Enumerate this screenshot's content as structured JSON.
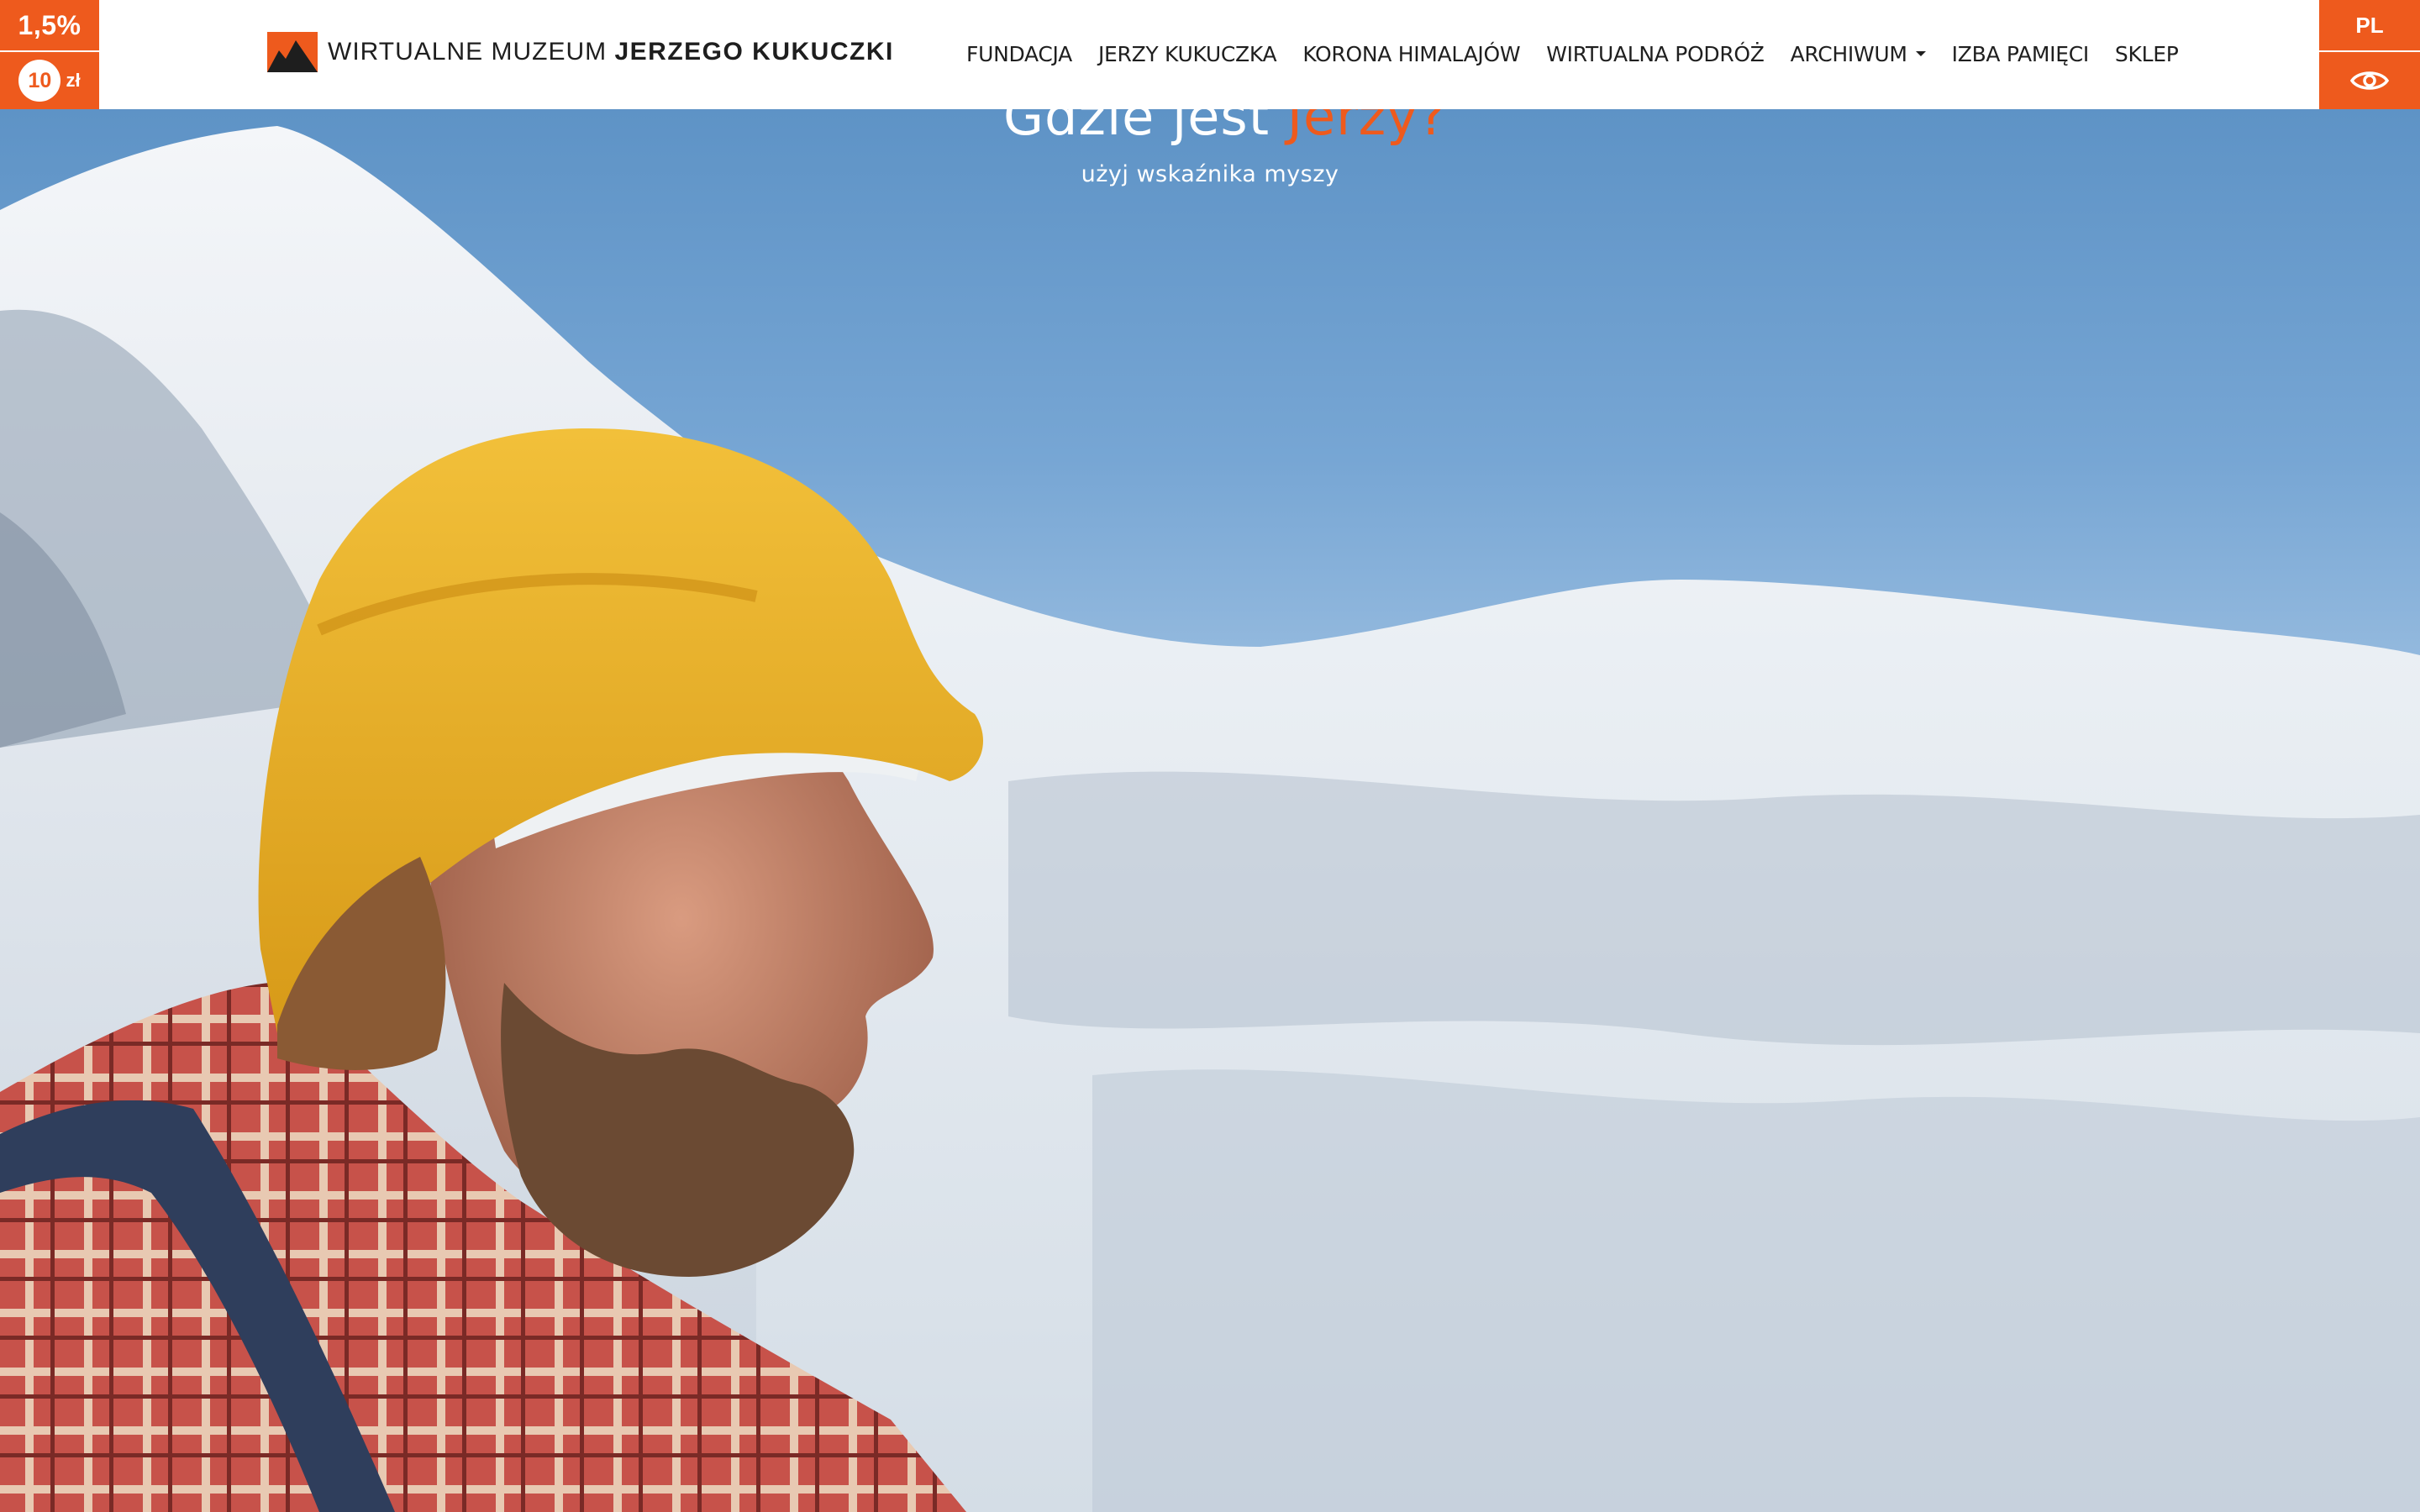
{
  "brand": {
    "logo_icon": "mountain-logo-icon",
    "text_regular": "WIRTUALNE MUZEUM",
    "text_bold": "JERZEGO KUKUCZKI",
    "accent_color": "#ee5a1d"
  },
  "tax_widget": {
    "percent": "1,5%",
    "amount": "10",
    "currency": "zł"
  },
  "nav": {
    "items": [
      {
        "label": "FUNDACJA"
      },
      {
        "label": "JERZY KUKUCZKA"
      },
      {
        "label": "KORONA HIMALAJÓW"
      },
      {
        "label": "WIRTUALNA PODRÓŻ"
      },
      {
        "label": "ARCHIWUM",
        "dropdown": true
      },
      {
        "label": "IZBA PAMIĘCI"
      },
      {
        "label": "SKLEP"
      }
    ]
  },
  "right_widget": {
    "language": "PL",
    "accessibility_icon": "eye-icon"
  },
  "hero": {
    "title_start": "Gdzie jest ",
    "title_accent": "Jerzy?",
    "subtitle": "użyj wskaźnika myszy"
  }
}
